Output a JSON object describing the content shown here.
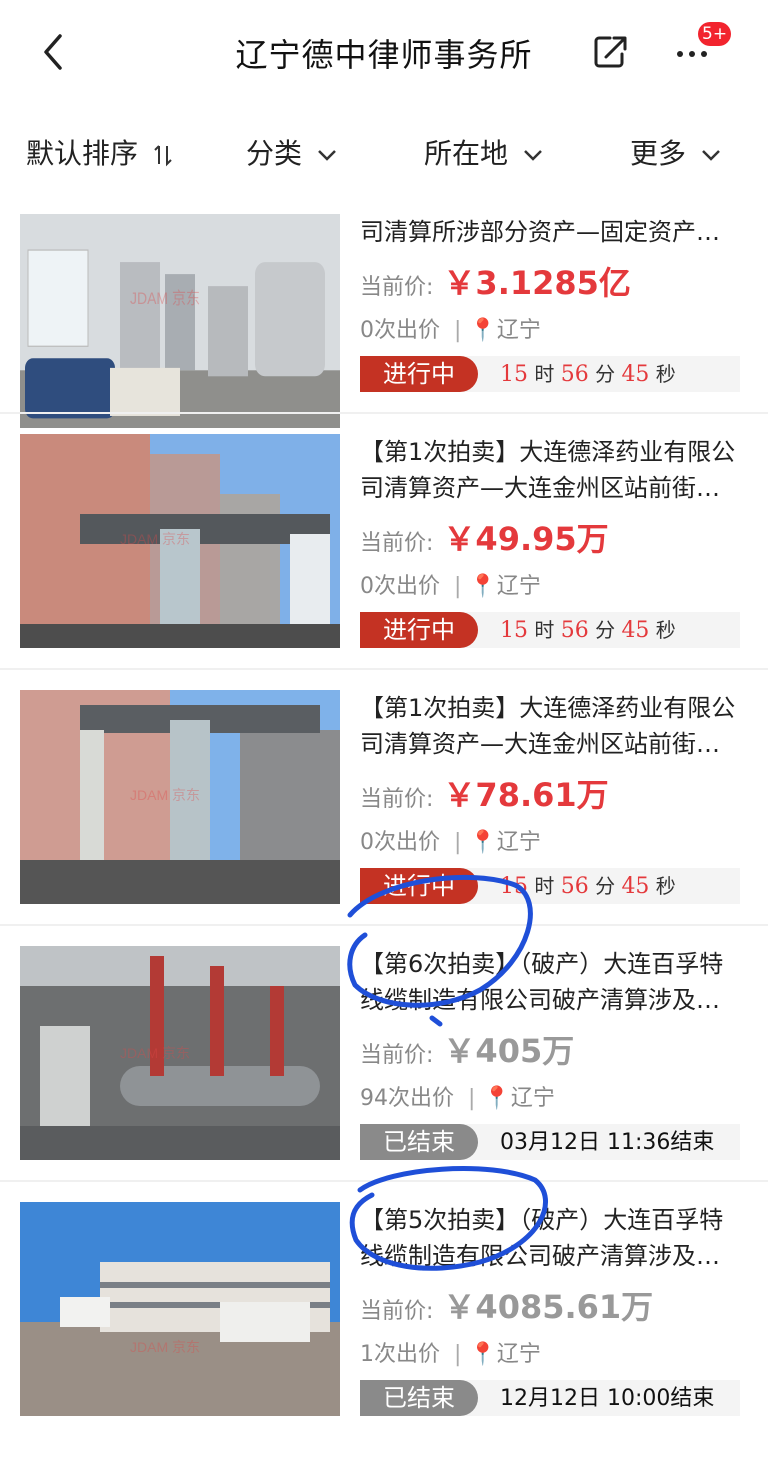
{
  "header": {
    "title": "辽宁德中律师事务所",
    "badge": "5+"
  },
  "filters": {
    "sort": "默认排序",
    "category": "分类",
    "location": "所在地",
    "more": "更多"
  },
  "watermark": "JDAM 京东",
  "cards": [
    {
      "line1": "司清算所涉部分资产—固定资产…",
      "line2": "",
      "price_label": "当前价:",
      "price": "￥3.1285亿",
      "bids": "0次出价",
      "location": "辽宁",
      "status": "进行中",
      "h": "15",
      "h_unit": "时",
      "m": "56",
      "m_unit": "分",
      "s": "45",
      "s_unit": "秒"
    },
    {
      "line1": "【第1次拍卖】大连德泽药业有限公",
      "line2": "司清算资产—大连金州区站前街…",
      "price_label": "当前价:",
      "price": "￥49.95万",
      "bids": "0次出价",
      "location": "辽宁",
      "status": "进行中",
      "h": "15",
      "h_unit": "时",
      "m": "56",
      "m_unit": "分",
      "s": "45",
      "s_unit": "秒"
    },
    {
      "line1": "【第1次拍卖】大连德泽药业有限公",
      "line2": "司清算资产—大连金州区站前街…",
      "price_label": "当前价:",
      "price": "￥78.61万",
      "bids": "0次出价",
      "location": "辽宁",
      "status": "进行中",
      "h": "15",
      "h_unit": "时",
      "m": "56",
      "m_unit": "分",
      "s": "45",
      "s_unit": "秒"
    },
    {
      "line1": "【第6次拍卖】（破产）大连百孚特",
      "line2": "线缆制造有限公司破产清算涉及…",
      "price_label": "当前价:",
      "price": "￥405万",
      "bids": "94次出价",
      "location": "辽宁",
      "status": "已结束",
      "end_text": "03月12日 11:36结束"
    },
    {
      "line1": "【第5次拍卖】（破产）大连百孚特",
      "line2": "线缆制造有限公司破产清算涉及…",
      "price_label": "当前价:",
      "price": "￥4085.61万",
      "bids": "1次出价",
      "location": "辽宁",
      "status": "已结束",
      "end_text": "12月12日 10:00结束"
    }
  ],
  "colors": {
    "price_active": "#e4393c",
    "pill_active": "#c43223",
    "pill_ended": "#8a8a8a",
    "annotation": "#1f4fd8"
  }
}
